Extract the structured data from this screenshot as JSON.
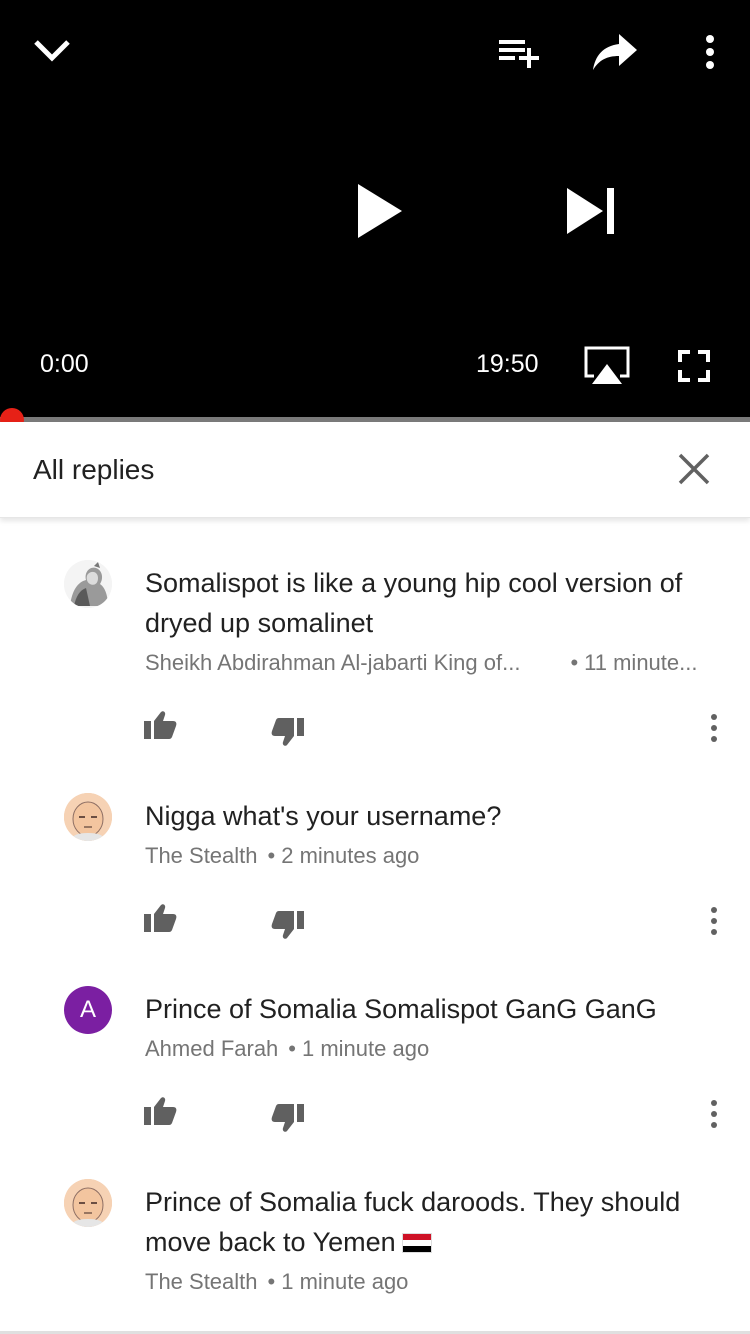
{
  "player": {
    "time_current": "0:00",
    "time_total": "19:50",
    "progress": 0.0
  },
  "replies_header": {
    "title": "All replies"
  },
  "comments": [
    {
      "text": "Somalispot is like a young hip cool version of dryed up somalinet",
      "author": "Sheikh Abdirahman Al-jabarti King of...",
      "time": "11 minute...",
      "avatar": "sketch-portrait"
    },
    {
      "text": "Nigga what's your username?",
      "author": "The Stealth",
      "time": "2 minutes ago",
      "avatar": "cartoon-bald-face"
    },
    {
      "text": "Prince of Somalia Somalispot GanG GanG",
      "author": "Ahmed Farah",
      "time": "1 minute ago",
      "avatar_letter": "A"
    },
    {
      "text": "Prince of Somalia fuck daroods. They should move back to Yemen",
      "author": "The Stealth",
      "time": "1 minute ago",
      "avatar": "cartoon-bald-face",
      "emoji": "yemen-flag"
    }
  ],
  "meta_separator": "•",
  "colors": {
    "accent": "#e62117",
    "avatar_letter_bg": "#7b1fa2",
    "meta_text": "#757575"
  }
}
